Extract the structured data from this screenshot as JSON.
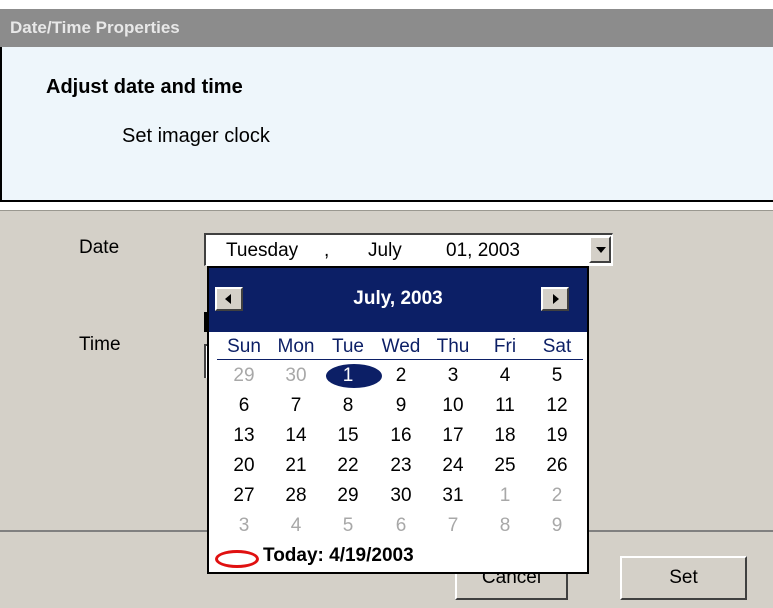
{
  "window": {
    "title": "Date/Time Properties"
  },
  "header": {
    "title": "Adjust date and time",
    "subtitle": "Set imager clock"
  },
  "form": {
    "date_label": "Date",
    "time_label": "Time",
    "date_value": {
      "weekday": "Tuesday",
      "sep1": ",",
      "month": "July",
      "day_year": "01, 2003"
    }
  },
  "buttons": {
    "cancel": "Cancel",
    "set": "Set"
  },
  "calendar": {
    "title": "July, 2003",
    "weekdays": [
      "Sun",
      "Mon",
      "Tue",
      "Wed",
      "Thu",
      "Fri",
      "Sat"
    ],
    "weeks": [
      [
        "29",
        "30",
        "1",
        "2",
        "3",
        "4",
        "5"
      ],
      [
        "6",
        "7",
        "8",
        "9",
        "10",
        "11",
        "12"
      ],
      [
        "13",
        "14",
        "15",
        "16",
        "17",
        "18",
        "19"
      ],
      [
        "20",
        "21",
        "22",
        "23",
        "24",
        "25",
        "26"
      ],
      [
        "27",
        "28",
        "29",
        "30",
        "31",
        "1",
        "2"
      ],
      [
        "3",
        "4",
        "5",
        "6",
        "7",
        "8",
        "9"
      ]
    ],
    "selected_day": "1",
    "today_label": "Today: 4/19/2003",
    "colors": {
      "header": "#0c1f66",
      "today_marker": "#e01010"
    }
  }
}
